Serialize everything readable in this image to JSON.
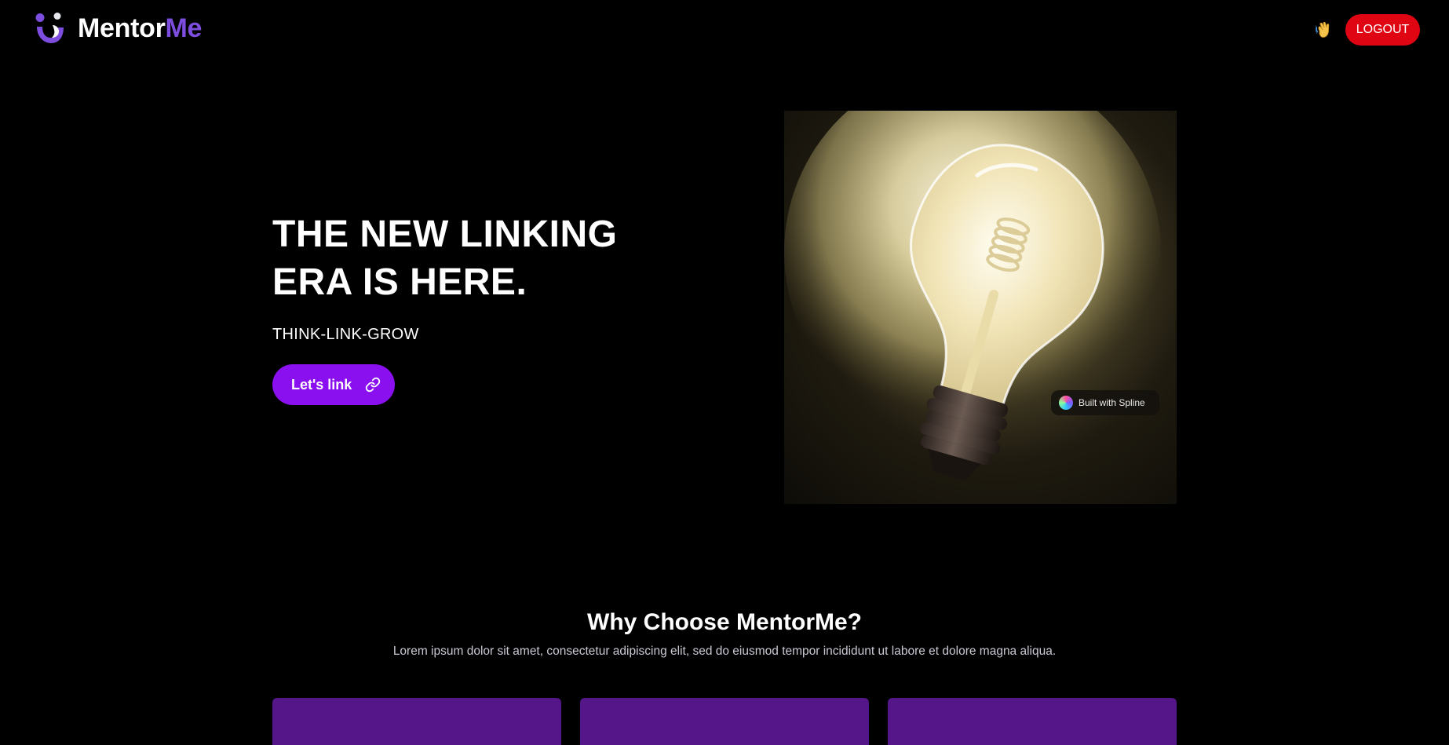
{
  "header": {
    "logo_part1": "Mentor",
    "logo_part2": "Me",
    "wave_icon": "waving-hand-icon",
    "logout_label": "LOGOUT"
  },
  "hero": {
    "title": "THE NEW LINKING\nERA IS HERE.",
    "tagline": "THINK-LINK-GROW",
    "cta_label": "Let's link",
    "cta_icon": "link-icon"
  },
  "scene": {
    "subject": "light-bulb",
    "badge_text": "Built with Spline"
  },
  "why": {
    "title": "Why Choose MentorMe?",
    "subtitle": "Lorem ipsum dolor sit amet, consectetur adipiscing elit, sed do eiusmod tempor incididunt ut labore et dolore magna aliqua."
  },
  "colors": {
    "background": "#000000",
    "accent_purple": "#8a10f0",
    "brand_purple": "#7c4dde",
    "logout_red": "#e00512",
    "card_purple": "#55168a"
  }
}
